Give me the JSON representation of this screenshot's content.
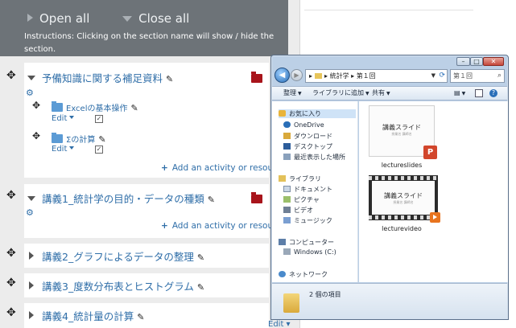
{
  "course_header": {
    "open_all": "Open all",
    "close_all": "Close all",
    "instructions": "Instructions: Clicking on the section name will show / hide the section."
  },
  "sections": [
    {
      "title": "予備知識に関する補足資料",
      "expanded": true,
      "activities": [
        {
          "name": "Excelの基本操作",
          "edit": "Edit"
        },
        {
          "name": "Σの計算",
          "edit": "Edit"
        }
      ],
      "add_activity": "Add an activity or resource"
    },
    {
      "title": "講義1_統計学の目的・データの種類",
      "expanded": true,
      "add_activity": "Add an activity or resource"
    },
    {
      "title": "講義2_グラフによるデータの整理",
      "expanded": false
    },
    {
      "title": "講義3_度数分布表とヒストグラム",
      "expanded": false
    },
    {
      "title": "講義4_統計量の計算",
      "expanded": false
    }
  ],
  "bottom_edit": "Edit",
  "explorer": {
    "title_buttons": {
      "minimize": "–",
      "maximize": "□",
      "close": "✕"
    },
    "breadcrumb": [
      "統計学",
      "第１回"
    ],
    "search_placeholder": "第１回",
    "toolbar": {
      "organize": "整理",
      "add_to_library": "ライブラリに追加",
      "share": "共有"
    },
    "nav": {
      "favorites": "お気に入り",
      "onedrive": "OneDrive",
      "downloads": "ダウンロード",
      "desktop": "デスクトップ",
      "recent": "最近表示した場所",
      "libraries": "ライブラリ",
      "documents": "ドキュメント",
      "pictures": "ピクチャ",
      "videos": "ビデオ",
      "music": "ミュージック",
      "computer": "コンピューター",
      "windows_c": "Windows (C:)",
      "network": "ネットワーク"
    },
    "files": [
      {
        "label": "lectureslides",
        "slide_title": "講義スライド",
        "slide_sub": "授業名 講師名",
        "kind": "powerpoint"
      },
      {
        "label": "lecturevideo",
        "slide_title": "講義スライド",
        "slide_sub": "授業名 講師名",
        "kind": "video"
      }
    ],
    "status": "2 個の項目"
  }
}
